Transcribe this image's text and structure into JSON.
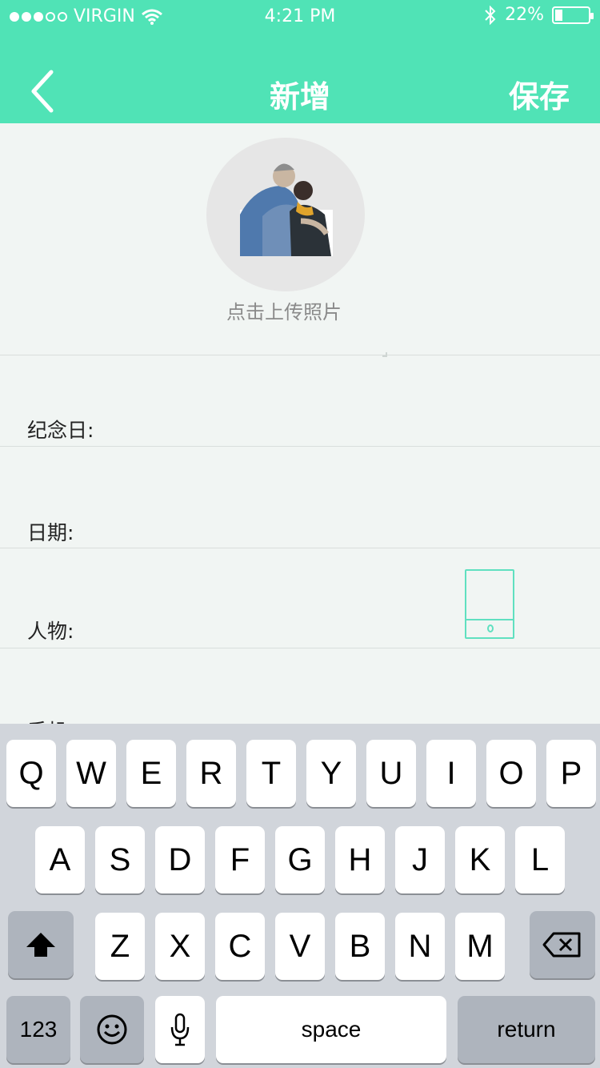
{
  "status_bar": {
    "carrier": "VIRGIN",
    "time": "4:21 PM",
    "battery": "22%",
    "battery_level": 0.22
  },
  "nav": {
    "title": "新增",
    "save_label": "保存"
  },
  "photo": {
    "upload_text": "点击上传照片"
  },
  "form": {
    "fields": [
      {
        "label": "纪念日:"
      },
      {
        "label": "日期:"
      },
      {
        "label": "人物:"
      },
      {
        "label": "手机:"
      }
    ]
  },
  "keyboard": {
    "row1": [
      "Q",
      "W",
      "E",
      "R",
      "T",
      "Y",
      "U",
      "I",
      "O",
      "P"
    ],
    "row2": [
      "A",
      "S",
      "D",
      "F",
      "G",
      "H",
      "J",
      "K",
      "L"
    ],
    "row3": [
      "Z",
      "X",
      "C",
      "V",
      "B",
      "N",
      "M"
    ],
    "numbers_label": "123",
    "space_label": "space",
    "return_label": "return"
  },
  "colors": {
    "accent": "#50e3b6",
    "keyboard_bg": "#d1d5db",
    "icon_outline": "#60e0c0"
  }
}
